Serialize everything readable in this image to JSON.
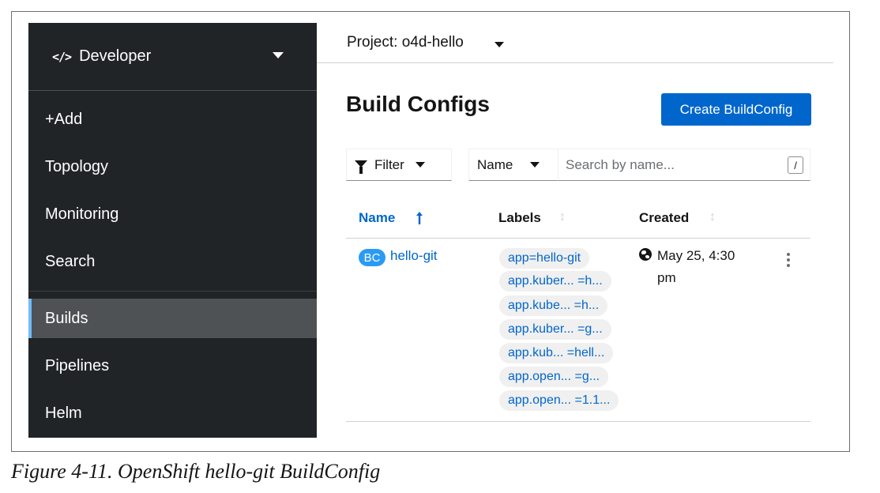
{
  "perspective": {
    "icon": "code-icon",
    "label": "Developer"
  },
  "nav": {
    "items": [
      {
        "label": "+Add"
      },
      {
        "label": "Topology"
      },
      {
        "label": "Monitoring"
      },
      {
        "label": "Search"
      },
      {
        "label": "Builds",
        "active": true
      },
      {
        "label": "Pipelines"
      },
      {
        "label": "Helm"
      }
    ]
  },
  "project": {
    "label": "Project: o4d-hello"
  },
  "page": {
    "title": "Build Configs",
    "create_button": "Create BuildConfig"
  },
  "toolbar": {
    "filter_label": "Filter",
    "attribute_label": "Name",
    "search_placeholder": "Search by name...",
    "shortcut_key": "/"
  },
  "table": {
    "headers": {
      "name": "Name",
      "labels": "Labels",
      "created": "Created"
    },
    "sorted_by": "Name",
    "rows": [
      {
        "badge": "BC",
        "name": "hello-git",
        "labels": [
          "app=hello-git",
          "app.kuber... =h...",
          "app.kube... =h...",
          "app.kuber... =g...",
          "app.kub... =hell...",
          "app.open... =g...",
          "app.open... =1.1..."
        ],
        "created_line1": "May 25, 4:30",
        "created_line2": "pm"
      }
    ]
  },
  "caption": "Figure 4-11. OpenShift hello-git BuildConfig",
  "colors": {
    "sidebar_bg": "#212427",
    "active_bg": "#4f5255",
    "active_accent": "#73bcf7",
    "primary": "#0066cc",
    "badge": "#2b9af3"
  }
}
